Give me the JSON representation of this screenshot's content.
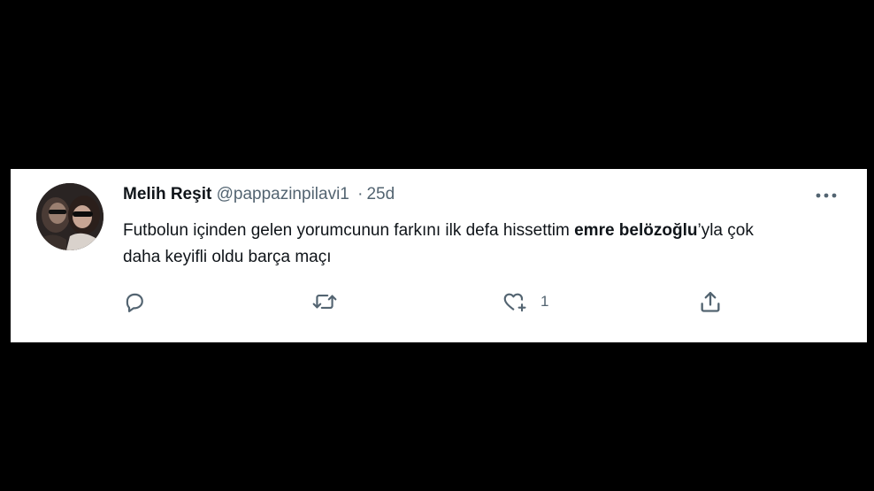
{
  "tweet": {
    "author": {
      "display_name": "Melih Reşit",
      "handle": "@pappazinpilavi1"
    },
    "separator": "·",
    "timestamp": "25d",
    "text": {
      "part1": "Futbolun içinden gelen yorumcunun farkını ilk defa hissettim ",
      "bold": "emre belözoğlu",
      "part2": "’yla çok daha keyifli oldu barça maçı"
    },
    "actions": {
      "reply": {
        "icon": "reply-icon"
      },
      "retweet": {
        "icon": "retweet-icon"
      },
      "like": {
        "icon": "heart-icon",
        "count": "1"
      },
      "share": {
        "icon": "share-icon"
      }
    },
    "more": {
      "icon": "more-options-icon"
    }
  },
  "colors": {
    "background": "#000000",
    "card": "#ffffff",
    "text_primary": "#0f1419",
    "text_secondary": "#536471"
  }
}
